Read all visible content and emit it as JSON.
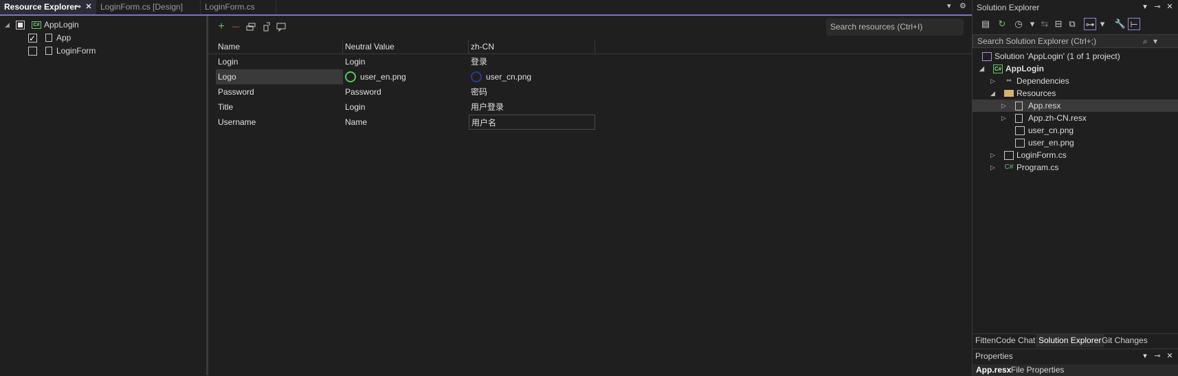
{
  "tabs": [
    {
      "label": "Resource Explorer",
      "active": true
    },
    {
      "label": "LoginForm.cs [Design]",
      "active": false
    },
    {
      "label": "LoginForm.cs",
      "active": false
    }
  ],
  "icons": {
    "pin": "⊸",
    "close": "✕",
    "dropdown": "▾",
    "gear": "⚙",
    "add": "+",
    "remove": "—",
    "chevron_expanded": "◢",
    "chevron_collapsed": "▷"
  },
  "left_tree": {
    "root": {
      "label": "AppLogin",
      "cs_badge": "C#"
    },
    "children": [
      {
        "label": "App",
        "checked": true
      },
      {
        "label": "LoginForm",
        "checked": false
      }
    ]
  },
  "resource_grid": {
    "search_placeholder": "Search resources (Ctrl+I)",
    "columns": [
      "Name",
      "Neutral Value",
      "zh-CN"
    ],
    "rows": [
      {
        "name": "Login",
        "neutral": "Login",
        "zh": "登录"
      },
      {
        "name": "Logo",
        "neutral": "user_en.png",
        "zh": "user_cn.png"
      },
      {
        "name": "Password",
        "neutral": "Password",
        "zh": "密码"
      },
      {
        "name": "Title",
        "neutral": "Login",
        "zh": "用户登录"
      },
      {
        "name": "Username",
        "neutral": "Name",
        "zh": "用户名"
      }
    ]
  },
  "solution_explorer": {
    "title": "Solution Explorer",
    "search_placeholder": "Search Solution Explorer (Ctrl+;)",
    "solution_label": "Solution 'AppLogin' (1 of 1 project)",
    "project_label": "AppLogin",
    "project_badge": "C#",
    "items": [
      {
        "label": "Dependencies"
      },
      {
        "label": "Resources"
      },
      {
        "label": "App.resx"
      },
      {
        "label": "App.zh-CN.resx"
      },
      {
        "label": "user_cn.png"
      },
      {
        "label": "user_en.png"
      },
      {
        "label": "LoginForm.cs"
      },
      {
        "label": "Program.cs",
        "badge": "C#"
      }
    ],
    "bottom_tabs": [
      "FittenCode Chat",
      "Solution Explorer",
      "Git Changes"
    ]
  },
  "properties": {
    "title": "Properties",
    "selected_name": "App.resx",
    "selected_type": "File Properties"
  },
  "colors": {
    "accent": "#7e72d6",
    "green_icon": "#6cc06c",
    "avatar_en": "#59c959",
    "avatar_cn": "#2c3a8f"
  }
}
